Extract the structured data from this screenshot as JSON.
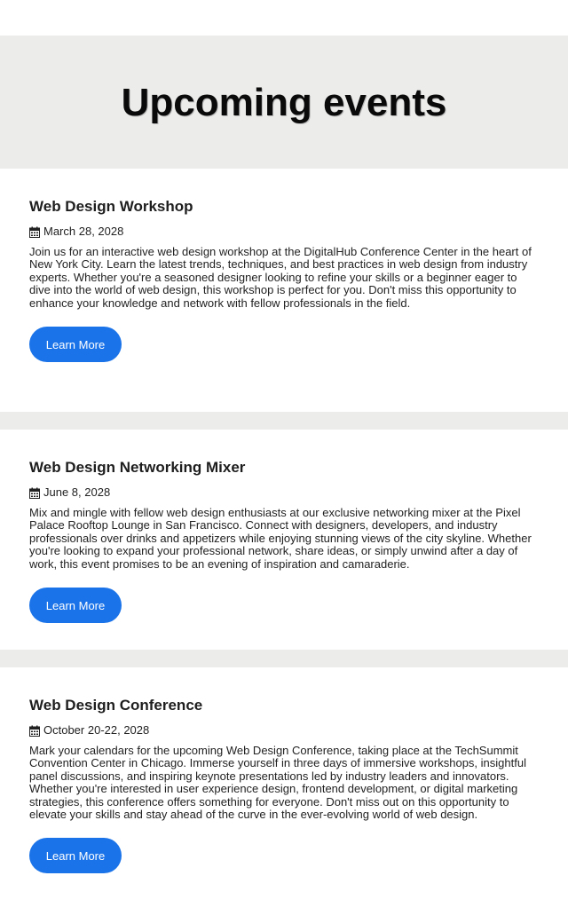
{
  "header": {
    "title": "Upcoming events"
  },
  "colors": {
    "accent": "#1a73e8",
    "band": "#ecedea",
    "background": "#ffffff"
  },
  "events": [
    {
      "title": "Web Design Workshop",
      "date_icon": "calendar-icon",
      "date": "March 28, 2028",
      "description": "Join us for an interactive web design workshop at the DigitalHub Conference Center in the heart of New York City. Learn the latest trends, techniques, and best practices in web design from industry experts. Whether you're a seasoned designer looking to refine your skills or a beginner eager to dive into the world of web design, this workshop is perfect for you. Don't miss this opportunity to enhance your knowledge and network with fellow professionals in the field.",
      "button_label": "Learn More"
    },
    {
      "title": "Web Design Networking Mixer",
      "date_icon": "calendar-icon",
      "date": "June 8, 2028",
      "description": "Mix and mingle with fellow web design enthusiasts at our exclusive networking mixer at the Pixel Palace Rooftop Lounge in San Francisco. Connect with designers, developers, and industry professionals over drinks and appetizers while enjoying stunning views of the city skyline. Whether you're looking to expand your professional network, share ideas, or simply unwind after a day of work, this event promises to be an evening of inspiration and camaraderie.",
      "button_label": "Learn More"
    },
    {
      "title": "Web Design Conference",
      "date_icon": "calendar-icon",
      "date": "October 20-22, 2028",
      "description": "Mark your calendars for the upcoming Web Design Conference, taking place at the TechSummit Convention Center in Chicago. Immerse yourself in three days of immersive workshops, insightful panel discussions, and inspiring keynote presentations led by industry leaders and innovators. Whether you're interested in user experience design, frontend development, or digital marketing strategies, this conference offers something for everyone. Don't miss out on this opportunity to elevate your skills and stay ahead of the curve in the ever-evolving world of web design.",
      "button_label": "Learn More"
    }
  ]
}
